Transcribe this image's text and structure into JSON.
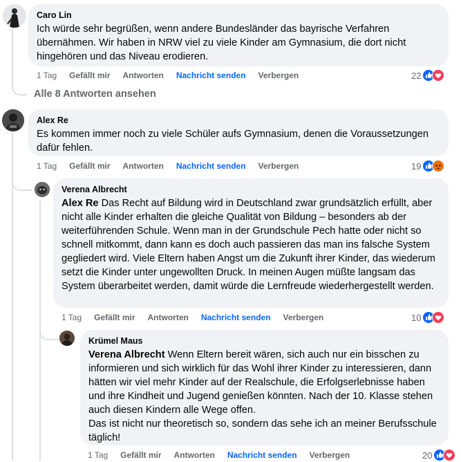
{
  "comments": [
    {
      "author": "Caro Lin",
      "text": "Ich würde sehr begrüßen, wenn andere Bundesländer das bayrische Verfahren übernähmen. Wir haben in NRW viel zu viele Kinder am Gymnasium, die dort nicht hingehören und das Niveau erodieren.",
      "time": "1 Tag",
      "like_label": "Gefällt mir",
      "reply_label": "Antworten",
      "send_label": "Nachricht senden",
      "hide_label": "Verbergen",
      "reaction_count": "22",
      "reactions": [
        "like-icon",
        "love-icon"
      ]
    },
    {
      "author": "Alex Re",
      "text": "Es kommen immer noch zu viele Schüler aufs Gymnasium, denen die Voraussetzungen dafür fehlen.",
      "time": "1 Tag",
      "like_label": "Gefällt mir",
      "reply_label": "Antworten",
      "send_label": "Nachricht senden",
      "hide_label": "Verbergen",
      "reaction_count": "19",
      "reactions": [
        "like-icon",
        "angry-icon"
      ]
    },
    {
      "author": "Verena Albrecht",
      "mention": "Alex Re",
      "text": " Das Recht auf Bildung wird in Deutschland zwar grundsätzlich erfüllt, aber nicht alle Kinder erhalten die gleiche Qualität von Bildung – besonders ab der weiterführenden Schule. Wenn man in der Grundschule Pech hatte oder nicht so schnell mitkommt, dann kann es doch auch passieren das man ins falsche System gegliedert wird. Viele Eltern haben Angst um die Zukunft ihrer Kinder, das wiederum setzt die Kinder unter ungewollten Druck. In meinen Augen müßte langsam das System überarbeitet werden, damit würde die Lernfreude wiederhergestellt werden.",
      "time": "1 Tag",
      "like_label": "Gefällt mir",
      "reply_label": "Antworten",
      "send_label": "Nachricht senden",
      "hide_label": "Verbergen",
      "reaction_count": "10",
      "reactions": [
        "like-icon",
        "love-icon"
      ]
    },
    {
      "author": "Krümel Maus",
      "mention": "Verena Albrecht",
      "text": " Wenn Eltern bereit wären, sich auch nur ein bisschen zu informieren und sich wirklich für das Wohl ihrer Kinder zu interessieren, dann hätten wir viel mehr Kinder auf der Realschule, die Erfolgserlebnisse haben und ihre Kindheit und Jugend genießen könnten. Nach der 10. Klasse stehen auch diesen Kindern alle Wege offen.\nDas ist nicht nur theoretisch so, sondern das sehe ich an meiner Berufsschule täglich!",
      "time": "1 Tag",
      "like_label": "Gefällt mir",
      "reply_label": "Antworten",
      "send_label": "Nachricht senden",
      "hide_label": "Verbergen",
      "reaction_count": "20",
      "reactions": [
        "like-icon",
        "love-icon"
      ]
    }
  ],
  "more_replies": "Alle 8 Antworten ansehen",
  "colors": {
    "bubble": "#f0f2f5",
    "link": "#0866ff",
    "meta": "#65676b",
    "like": "#0866ff",
    "love": "#f33e58",
    "angry": "#e9710f"
  }
}
